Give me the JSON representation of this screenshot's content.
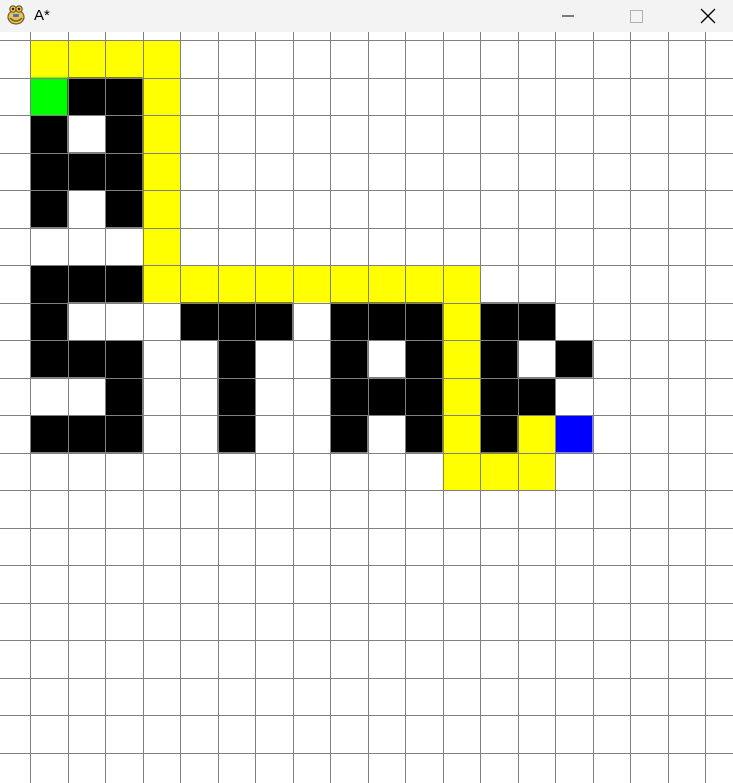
{
  "window": {
    "title": "A*"
  },
  "icons": {
    "app": "python-snake-icon",
    "minimize": "minimize-icon",
    "maximize": "maximize-icon",
    "close": "close-icon"
  },
  "colors": {
    "background": "#ffffff",
    "grid_line": "#808080",
    "wall": "#000000",
    "path": "#ffff00",
    "start": "#00ff00",
    "end": "#0000ff",
    "titlebar": "#f3f3f3"
  },
  "grid": {
    "columns": 20,
    "rows": 20,
    "start": [
      0,
      1
    ],
    "end": [
      14,
      10
    ],
    "walls": [
      [
        1,
        1
      ],
      [
        2,
        1
      ],
      [
        0,
        2
      ],
      [
        2,
        2
      ],
      [
        0,
        3
      ],
      [
        1,
        3
      ],
      [
        2,
        3
      ],
      [
        0,
        4
      ],
      [
        2,
        4
      ],
      [
        0,
        6
      ],
      [
        1,
        6
      ],
      [
        2,
        6
      ],
      [
        0,
        7
      ],
      [
        4,
        7
      ],
      [
        5,
        7
      ],
      [
        6,
        7
      ],
      [
        8,
        7
      ],
      [
        9,
        7
      ],
      [
        10,
        7
      ],
      [
        12,
        7
      ],
      [
        13,
        7
      ],
      [
        0,
        8
      ],
      [
        1,
        8
      ],
      [
        2,
        8
      ],
      [
        5,
        8
      ],
      [
        8,
        8
      ],
      [
        10,
        8
      ],
      [
        12,
        8
      ],
      [
        14,
        8
      ],
      [
        2,
        9
      ],
      [
        5,
        9
      ],
      [
        8,
        9
      ],
      [
        9,
        9
      ],
      [
        10,
        9
      ],
      [
        12,
        9
      ],
      [
        13,
        9
      ],
      [
        0,
        10
      ],
      [
        1,
        10
      ],
      [
        2,
        10
      ],
      [
        5,
        10
      ],
      [
        8,
        10
      ],
      [
        10,
        10
      ],
      [
        12,
        10
      ]
    ],
    "path": [
      [
        0,
        0
      ],
      [
        1,
        0
      ],
      [
        2,
        0
      ],
      [
        3,
        0
      ],
      [
        3,
        1
      ],
      [
        3,
        2
      ],
      [
        3,
        3
      ],
      [
        3,
        4
      ],
      [
        3,
        5
      ],
      [
        3,
        6
      ],
      [
        4,
        6
      ],
      [
        5,
        6
      ],
      [
        6,
        6
      ],
      [
        7,
        6
      ],
      [
        8,
        6
      ],
      [
        9,
        6
      ],
      [
        10,
        6
      ],
      [
        11,
        6
      ],
      [
        11,
        7
      ],
      [
        11,
        8
      ],
      [
        11,
        9
      ],
      [
        11,
        10
      ],
      [
        11,
        11
      ],
      [
        12,
        11
      ],
      [
        13,
        11
      ],
      [
        13,
        10
      ]
    ]
  }
}
